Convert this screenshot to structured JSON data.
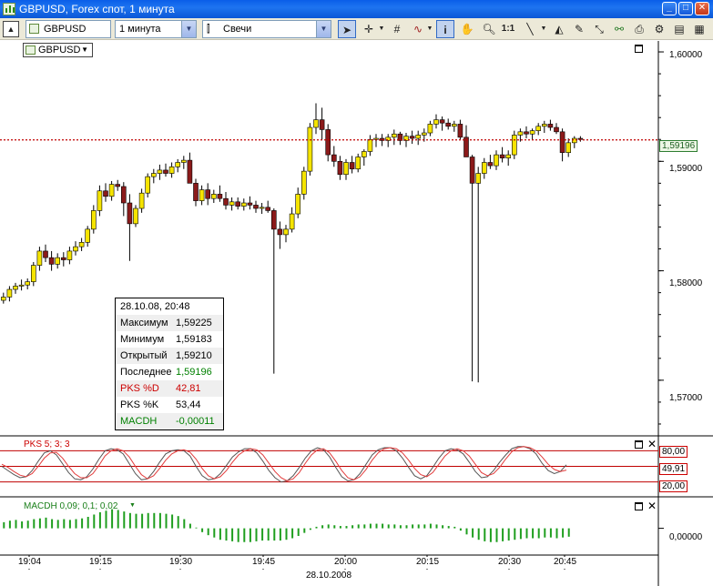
{
  "window": {
    "title": "GBPUSD, Forex спот, 1 минута"
  },
  "toolbar": {
    "instrument": "GBPUSD",
    "timeframe": "1 минута",
    "chart_style": "Свечи",
    "zoom_label": "1:1"
  },
  "instrument_tag": "GBPUSD",
  "price_axis": {
    "ticks": [
      "1,60000",
      "1,59000",
      "1,58000",
      "1,57000"
    ],
    "current_price": "1,59196"
  },
  "time_axis": {
    "ticks": [
      "19:04",
      "19:15",
      "19:30",
      "19:45",
      "20:00",
      "20:15",
      "20:30",
      "20:45"
    ],
    "date": "28.10.2008"
  },
  "info_panel": {
    "datetime": "28.10.08, 20:48",
    "rows": [
      {
        "label": "Максимум",
        "value": "1,59225"
      },
      {
        "label": "Минимум",
        "value": "1,59183"
      },
      {
        "label": "Открытый",
        "value": "1,59210"
      },
      {
        "label": "Последнее",
        "value": "1,59196"
      },
      {
        "label": "PKS %D",
        "value": "42,81"
      },
      {
        "label": "PKS %K",
        "value": "53,44"
      },
      {
        "label": "MACDH",
        "value": "-0,00011"
      }
    ]
  },
  "pks_panel": {
    "title": "PKS 5; 3; 3",
    "levels": [
      "80,00",
      "49,91",
      "20,00"
    ]
  },
  "macd_panel": {
    "title": "MACDH 0,09; 0,1; 0,02",
    "zero_label": "0,00000"
  },
  "colors": {
    "candle_up": "#f5e400",
    "candle_down": "#8b1a1a",
    "wick": "#000000",
    "price_line": "#c00000",
    "pks_d": "#e23b3b",
    "pks_k": "#555555",
    "macd": "#1e9e1e",
    "last_price_green": "#008000",
    "pks_label_red": "#cc0000"
  },
  "chart_data": [
    {
      "type": "candlestick",
      "title": "GBPUSD",
      "x_range": [
        "19:04",
        "20:49"
      ],
      "ylim": [
        1.565,
        1.601
      ],
      "grid": false,
      "candles": [
        [
          1.5773,
          1.578,
          1.577,
          1.5776
        ],
        [
          1.5776,
          1.5786,
          1.5772,
          1.5783
        ],
        [
          1.5783,
          1.5789,
          1.5779,
          1.5786
        ],
        [
          1.5786,
          1.5792,
          1.5782,
          1.5787
        ],
        [
          1.5787,
          1.5793,
          1.5783,
          1.579
        ],
        [
          1.579,
          1.5808,
          1.5786,
          1.5805
        ],
        [
          1.5805,
          1.5822,
          1.58,
          1.5818
        ],
        [
          1.5818,
          1.5824,
          1.5808,
          1.5812
        ],
        [
          1.5812,
          1.5818,
          1.58,
          1.5806
        ],
        [
          1.5806,
          1.5816,
          1.5802,
          1.5812
        ],
        [
          1.5812,
          1.5817,
          1.5804,
          1.581
        ],
        [
          1.581,
          1.5822,
          1.5806,
          1.5818
        ],
        [
          1.5818,
          1.5827,
          1.5814,
          1.5822
        ],
        [
          1.5822,
          1.583,
          1.5818,
          1.5826
        ],
        [
          1.5826,
          1.5841,
          1.5822,
          1.5838
        ],
        [
          1.5838,
          1.586,
          1.5834,
          1.5855
        ],
        [
          1.5855,
          1.5878,
          1.585,
          1.5873
        ],
        [
          1.5873,
          1.588,
          1.5863,
          1.5868
        ],
        [
          1.5868,
          1.5882,
          1.5864,
          1.5879
        ],
        [
          1.5879,
          1.5883,
          1.5873,
          1.5877
        ],
        [
          1.5877,
          1.5881,
          1.585,
          1.5862
        ],
        [
          1.5862,
          1.587,
          1.5809,
          1.5843
        ],
        [
          1.5843,
          1.586,
          1.584,
          1.5857
        ],
        [
          1.5857,
          1.5875,
          1.5853,
          1.5871
        ],
        [
          1.5871,
          1.5889,
          1.5867,
          1.5886
        ],
        [
          1.5886,
          1.5893,
          1.588,
          1.5889
        ],
        [
          1.5889,
          1.5897,
          1.5883,
          1.5892
        ],
        [
          1.5892,
          1.5898,
          1.5886,
          1.5889
        ],
        [
          1.5889,
          1.5899,
          1.5885,
          1.5895
        ],
        [
          1.5895,
          1.5902,
          1.589,
          1.5899
        ],
        [
          1.5899,
          1.5905,
          1.5893,
          1.5901
        ],
        [
          1.5901,
          1.5908,
          1.5897,
          1.588
        ],
        [
          1.588,
          1.5884,
          1.5859,
          1.5864
        ],
        [
          1.5864,
          1.5878,
          1.586,
          1.5874
        ],
        [
          1.5874,
          1.588,
          1.586,
          1.5866
        ],
        [
          1.5866,
          1.5874,
          1.5862,
          1.587
        ],
        [
          1.587,
          1.5878,
          1.5863,
          1.5866
        ],
        [
          1.5866,
          1.5872,
          1.5856,
          1.586
        ],
        [
          1.586,
          1.5867,
          1.5855,
          1.5863
        ],
        [
          1.5863,
          1.5867,
          1.5856,
          1.5859
        ],
        [
          1.5859,
          1.5866,
          1.5855,
          1.5862
        ],
        [
          1.5862,
          1.5868,
          1.5856,
          1.586
        ],
        [
          1.586,
          1.5864,
          1.5853,
          1.5857
        ],
        [
          1.5857,
          1.5862,
          1.5852,
          1.5858
        ],
        [
          1.5858,
          1.5864,
          1.5853,
          1.5855
        ],
        [
          1.5855,
          1.5857,
          1.5706,
          1.5838
        ],
        [
          1.5838,
          1.5845,
          1.582,
          1.5833
        ],
        [
          1.5833,
          1.5842,
          1.5826,
          1.5838
        ],
        [
          1.5838,
          1.5858,
          1.5835,
          1.5852
        ],
        [
          1.5852,
          1.5876,
          1.5848,
          1.587
        ],
        [
          1.587,
          1.5895,
          1.5865,
          1.5891
        ],
        [
          1.5891,
          1.5935,
          1.5887,
          1.5931
        ],
        [
          1.5931,
          1.5953,
          1.5925,
          1.5938
        ],
        [
          1.5938,
          1.5949,
          1.592,
          1.5929
        ],
        [
          1.5929,
          1.5934,
          1.59,
          1.5906
        ],
        [
          1.5906,
          1.5914,
          1.5895,
          1.59
        ],
        [
          1.59,
          1.5905,
          1.5883,
          1.5888
        ],
        [
          1.5888,
          1.5902,
          1.5883,
          1.5899
        ],
        [
          1.5899,
          1.5905,
          1.5889,
          1.5893
        ],
        [
          1.5893,
          1.5907,
          1.589,
          1.5904
        ],
        [
          1.5904,
          1.5911,
          1.5896,
          1.5909
        ],
        [
          1.5909,
          1.5924,
          1.5905,
          1.592
        ],
        [
          1.592,
          1.5925,
          1.5913,
          1.5921
        ],
        [
          1.5921,
          1.5925,
          1.5914,
          1.5919
        ],
        [
          1.5919,
          1.5925,
          1.5913,
          1.5922
        ],
        [
          1.5922,
          1.5929,
          1.5915,
          1.5925
        ],
        [
          1.5925,
          1.5927,
          1.5915,
          1.5919
        ],
        [
          1.5919,
          1.5926,
          1.5913,
          1.5923
        ],
        [
          1.5923,
          1.5928,
          1.5916,
          1.5921
        ],
        [
          1.5921,
          1.5928,
          1.5915,
          1.5924
        ],
        [
          1.5924,
          1.593,
          1.5918,
          1.5926
        ],
        [
          1.5926,
          1.5937,
          1.5923,
          1.5934
        ],
        [
          1.5934,
          1.5943,
          1.593,
          1.5938
        ],
        [
          1.5938,
          1.5941,
          1.5928,
          1.5935
        ],
        [
          1.5935,
          1.5939,
          1.5929,
          1.5932
        ],
        [
          1.5932,
          1.5937,
          1.5927,
          1.5934
        ],
        [
          1.5934,
          1.5938,
          1.592,
          1.5922
        ],
        [
          1.5922,
          1.5933,
          1.5911,
          1.5904
        ],
        [
          1.5904,
          1.5906,
          1.5699,
          1.588
        ],
        [
          1.588,
          1.5895,
          1.5698,
          1.5889
        ],
        [
          1.5889,
          1.5903,
          1.5884,
          1.5899
        ],
        [
          1.5899,
          1.5906,
          1.5893,
          1.5896
        ],
        [
          1.5896,
          1.591,
          1.5892,
          1.5906
        ],
        [
          1.5906,
          1.5913,
          1.5899,
          1.5903
        ],
        [
          1.5903,
          1.591,
          1.5896,
          1.5906
        ],
        [
          1.5906,
          1.5928,
          1.5902,
          1.5924
        ],
        [
          1.5924,
          1.593,
          1.5918,
          1.5927
        ],
        [
          1.5927,
          1.5932,
          1.5921,
          1.5925
        ],
        [
          1.5925,
          1.593,
          1.592,
          1.5928
        ],
        [
          1.5928,
          1.5935,
          1.5924,
          1.5932
        ],
        [
          1.5932,
          1.5937,
          1.5926,
          1.5934
        ],
        [
          1.5934,
          1.5938,
          1.5928,
          1.5931
        ],
        [
          1.5931,
          1.5935,
          1.5925,
          1.5927
        ],
        [
          1.5927,
          1.593,
          1.59,
          1.5908
        ],
        [
          1.5908,
          1.5921,
          1.5904,
          1.5917
        ],
        [
          1.5917,
          1.5923,
          1.5912,
          1.5921
        ],
        [
          1.5921,
          1.5923,
          1.5918,
          1.592
        ]
      ],
      "current_price": 1.59196
    },
    {
      "type": "line",
      "title": "PKS 5; 3; 3",
      "ylim": [
        0,
        100
      ],
      "levels": [
        80,
        49.91,
        20
      ],
      "series": [
        {
          "name": "PKS %K",
          "values": [
            50,
            42,
            34,
            28,
            30,
            42,
            60,
            76,
            80,
            72,
            55,
            38,
            26,
            24,
            30,
            45,
            64,
            80,
            84,
            82,
            74,
            55,
            36,
            24,
            26,
            40,
            58,
            74,
            80,
            82,
            80,
            70,
            50,
            32,
            24,
            26,
            36,
            52,
            68,
            78,
            84,
            84,
            76,
            60,
            42,
            28,
            20,
            22,
            32,
            48,
            66,
            80,
            86,
            82,
            68,
            48,
            30,
            22,
            24,
            36,
            54,
            72,
            82,
            86,
            86,
            80,
            66,
            48,
            32,
            26,
            32,
            48,
            66,
            80,
            84,
            82,
            74,
            58,
            40,
            28,
            30,
            42,
            58,
            72,
            84,
            88,
            88,
            84,
            74,
            56,
            42,
            36,
            40,
            53
          ]
        },
        {
          "name": "PKS %D",
          "values": [
            54,
            48,
            40,
            33,
            30,
            36,
            50,
            66,
            76,
            77,
            66,
            50,
            36,
            28,
            28,
            36,
            52,
            70,
            80,
            84,
            80,
            68,
            50,
            34,
            26,
            32,
            46,
            62,
            74,
            80,
            82,
            77,
            64,
            46,
            32,
            26,
            30,
            42,
            58,
            72,
            80,
            84,
            82,
            72,
            56,
            40,
            28,
            22,
            26,
            38,
            56,
            72,
            82,
            84,
            76,
            60,
            42,
            28,
            24,
            30,
            44,
            62,
            76,
            84,
            86,
            84,
            76,
            62,
            46,
            34,
            30,
            38,
            54,
            70,
            80,
            84,
            80,
            70,
            54,
            38,
            32,
            36,
            48,
            64,
            78,
            86,
            88,
            86,
            80,
            68,
            54,
            44,
            40,
            42.81
          ]
        }
      ]
    },
    {
      "type": "bar",
      "title": "MACDH 0,09; 0,1; 0,02",
      "ylim": [
        -0.00035,
        0.0004
      ],
      "values": [
        8e-05,
        0.0001,
        0.00011,
        9e-05,
        0.0001,
        0.00012,
        0.00013,
        0.00014,
        0.00012,
        0.00011,
        0.00012,
        0.00011,
        0.00012,
        0.00013,
        0.00015,
        0.00018,
        0.00021,
        0.00023,
        0.00025,
        0.00024,
        0.00022,
        0.0002,
        0.00019,
        0.00019,
        0.0002,
        0.0002,
        0.0002,
        0.00019,
        0.00018,
        0.00016,
        0.00012,
        6e-05,
        1e-05,
        -5e-05,
        -9e-05,
        -0.00012,
        -0.00015,
        -0.00016,
        -0.00017,
        -0.00018,
        -0.00018,
        -0.00018,
        -0.00017,
        -0.00016,
        -0.00016,
        -0.00016,
        -0.00016,
        -0.00015,
        -0.00013,
        -0.0001,
        -6e-05,
        -2e-05,
        2e-05,
        4e-05,
        5e-05,
        4e-05,
        3e-05,
        3e-05,
        4e-05,
        5e-05,
        5e-05,
        6e-05,
        6e-05,
        6e-05,
        5e-05,
        5e-05,
        4e-05,
        4e-05,
        5e-05,
        5e-05,
        5e-05,
        6e-05,
        5e-05,
        4e-05,
        3e-05,
        2e-05,
        -3e-05,
        -8e-05,
        -0.00012,
        -0.00015,
        -0.00017,
        -0.00018,
        -0.00018,
        -0.00017,
        -0.00016,
        -0.00015,
        -0.00014,
        -0.00013,
        -0.00013,
        -0.00013,
        -0.00012,
        -0.00012,
        -0.00013,
        -0.00012,
        -0.00011
      ]
    }
  ]
}
